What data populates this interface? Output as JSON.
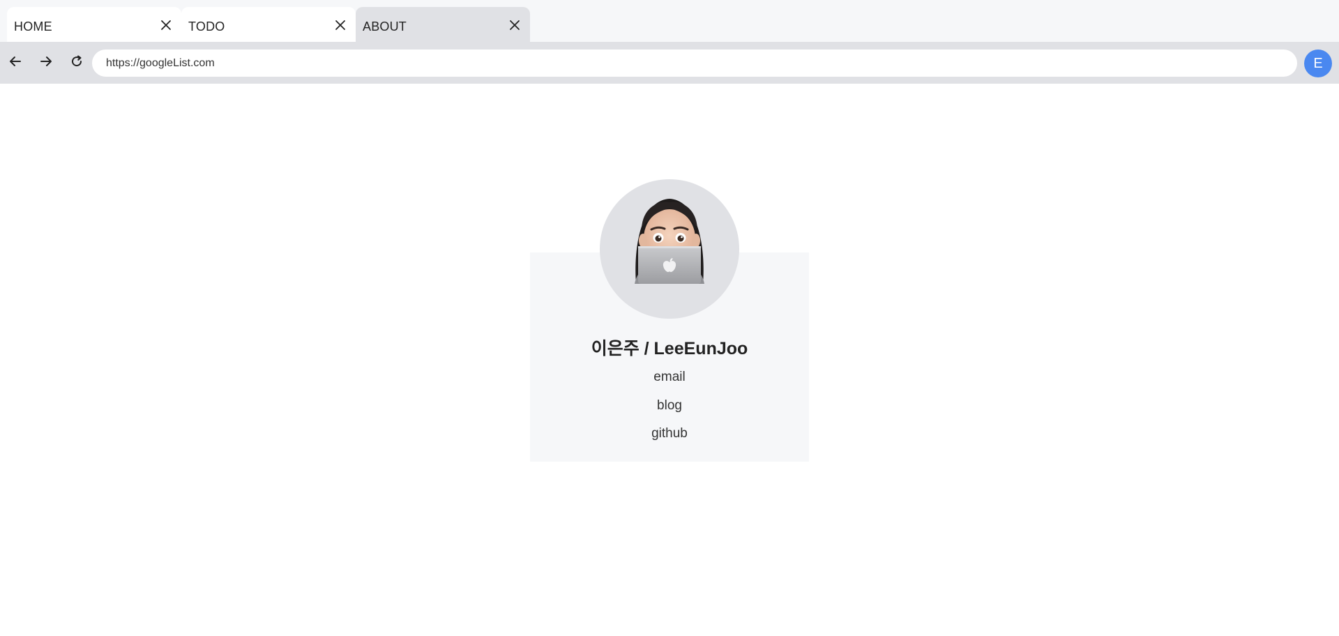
{
  "tabs": [
    {
      "label": "HOME"
    },
    {
      "label": "TODO"
    },
    {
      "label": "ABOUT"
    }
  ],
  "address_bar": {
    "url": "https://googleList.com"
  },
  "profile_button": {
    "initial": "E"
  },
  "profile_card": {
    "name": "이은주 / LeeEunJoo",
    "links": [
      {
        "label": "email"
      },
      {
        "label": "blog"
      },
      {
        "label": "github"
      }
    ]
  },
  "colors": {
    "tab_strip_bg": "#f6f7f9",
    "active_tab_bg": "#e0e1e5",
    "toolbar_bg": "#e0e1e5",
    "profile_accent": "#4a88f0",
    "card_bg": "#f6f7f9",
    "avatar_bg": "#e0e1e5"
  },
  "icons": {
    "back": "arrow-left-icon",
    "forward": "arrow-right-icon",
    "reload": "reload-icon",
    "close": "close-icon"
  }
}
